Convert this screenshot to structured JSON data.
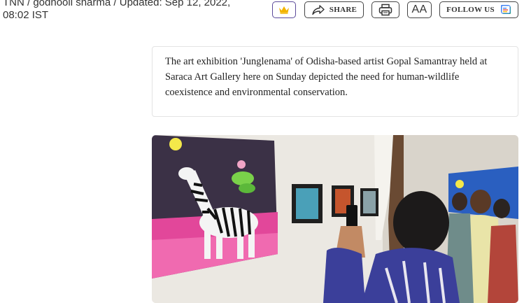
{
  "byline": {
    "text": "TNN / godhooli sharma / Updated: Sep 12, 2022, 08:02 IST"
  },
  "toolbar": {
    "share_label": "SHARE",
    "font_label": "AA",
    "follow_label": "FOLLOW US",
    "icons": {
      "crown": "crown-icon",
      "share": "share-arrow-icon",
      "print": "printer-icon",
      "google_news": "google-news-icon"
    }
  },
  "article": {
    "summary": "The art exhibition 'Junglenama' of Odisha-based artist Gopal Samantray held at Saraca Art Gallery here on Sunday depicted the need for human-wildlife coexistence and environmental conservation."
  },
  "colors": {
    "crown_gold": "#f2b400",
    "crown_border": "#5b4a9a",
    "text": "#222222"
  }
}
